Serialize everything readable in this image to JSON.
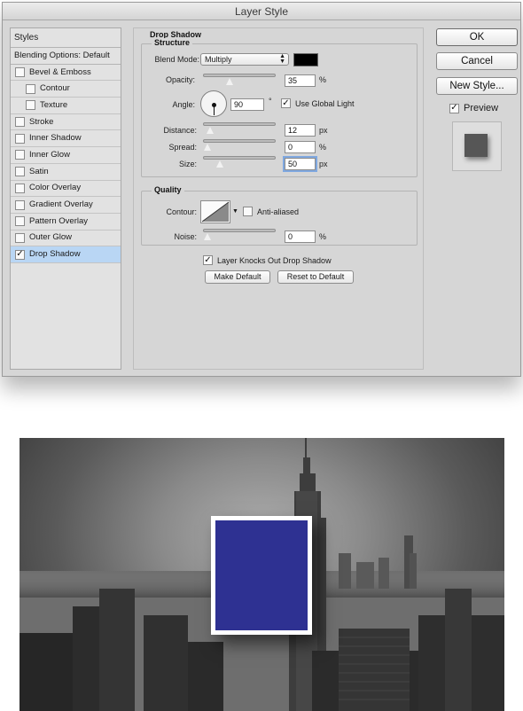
{
  "dialog": {
    "title": "Layer Style"
  },
  "styles_panel": {
    "header": "Styles",
    "blending_options": "Blending Options: Default",
    "items": [
      {
        "label": "Bevel & Emboss",
        "checked": false,
        "sub": false,
        "selected": false
      },
      {
        "label": "Contour",
        "checked": false,
        "sub": true,
        "selected": false
      },
      {
        "label": "Texture",
        "checked": false,
        "sub": true,
        "selected": false
      },
      {
        "label": "Stroke",
        "checked": false,
        "sub": false,
        "selected": false
      },
      {
        "label": "Inner Shadow",
        "checked": false,
        "sub": false,
        "selected": false
      },
      {
        "label": "Inner Glow",
        "checked": false,
        "sub": false,
        "selected": false
      },
      {
        "label": "Satin",
        "checked": false,
        "sub": false,
        "selected": false
      },
      {
        "label": "Color Overlay",
        "checked": false,
        "sub": false,
        "selected": false
      },
      {
        "label": "Gradient Overlay",
        "checked": false,
        "sub": false,
        "selected": false
      },
      {
        "label": "Pattern Overlay",
        "checked": false,
        "sub": false,
        "selected": false
      },
      {
        "label": "Outer Glow",
        "checked": false,
        "sub": false,
        "selected": false
      },
      {
        "label": "Drop Shadow",
        "checked": true,
        "sub": false,
        "selected": true
      }
    ]
  },
  "drop_shadow": {
    "title": "Drop Shadow",
    "structure": {
      "title": "Structure",
      "blend_mode_label": "Blend Mode:",
      "blend_mode_value": "Multiply",
      "shadow_color": "#000000",
      "opacity_label": "Opacity:",
      "opacity_value": "35",
      "opacity_unit": "%",
      "opacity_fraction": 0.35,
      "angle_label": "Angle:",
      "angle_value": "90",
      "angle_unit": "°",
      "use_global_light_label": "Use Global Light",
      "use_global_light_checked": true,
      "distance_label": "Distance:",
      "distance_value": "12",
      "distance_unit": "px",
      "distance_fraction": 0.04,
      "spread_label": "Spread:",
      "spread_value": "0",
      "spread_unit": "%",
      "spread_fraction": 0.0,
      "size_label": "Size:",
      "size_value": "50",
      "size_unit": "px",
      "size_fraction": 0.2
    },
    "quality": {
      "title": "Quality",
      "contour_label": "Contour:",
      "anti_aliased_label": "Anti-aliased",
      "anti_aliased_checked": false,
      "noise_label": "Noise:",
      "noise_value": "0",
      "noise_unit": "%",
      "noise_fraction": 0.0
    },
    "knockout_label": "Layer Knocks Out Drop Shadow",
    "knockout_checked": true,
    "make_default_label": "Make Default",
    "reset_default_label": "Reset to Default"
  },
  "buttons": {
    "ok": "OK",
    "cancel": "Cancel",
    "new_style": "New Style...",
    "preview_label": "Preview",
    "preview_checked": true
  },
  "colors": {
    "card_fill": "#2e3192",
    "card_border": "#ffffff",
    "selection": "#b9d6f4"
  }
}
